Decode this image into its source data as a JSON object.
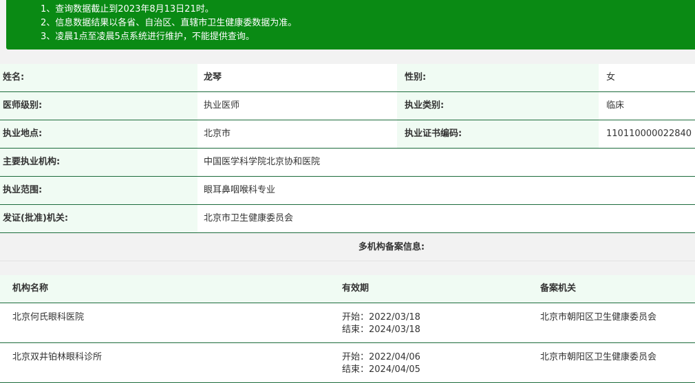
{
  "notice": {
    "lines": [
      "1、查询数据截止到2023年8月13日21时。",
      "2、信息数据结果以各省、自治区、直辖市卫生健康委数据为准。",
      "3、凌晨1点至凌晨5点系统进行维护，不能提供查询。"
    ]
  },
  "info": {
    "name_label": "姓名:",
    "name_value": "龙琴",
    "gender_label": "性别:",
    "gender_value": "女",
    "level_label": "医师级别:",
    "level_value": "执业医师",
    "category_label": "执业类别:",
    "category_value": "临床",
    "location_label": "执业地点:",
    "location_value": "北京市",
    "cert_label": "执业证书编码:",
    "cert_value": "110110000022840",
    "institution_label": "主要执业机构:",
    "institution_value": "中国医学科学院北京协和医院",
    "scope_label": "执业范围:",
    "scope_value": "眼耳鼻咽喉科专业",
    "issuer_label": "发证(批准)机关:",
    "issuer_value": "北京市卫生健康委员会"
  },
  "multi": {
    "title": "多机构备案信息:",
    "headers": {
      "name": "机构名称",
      "period": "有效期",
      "authority": "备案机关"
    },
    "rows": [
      {
        "name": "北京何氏眼科医院",
        "start": "开始：2022/03/18",
        "end": "结束：2024/03/18",
        "authority": "北京市朝阳区卫生健康委员会"
      },
      {
        "name": "北京双井铂林眼科诊所",
        "start": "开始：2022/04/06",
        "end": "结束：2024/04/05",
        "authority": "北京市朝阳区卫生健康委员会"
      }
    ]
  }
}
